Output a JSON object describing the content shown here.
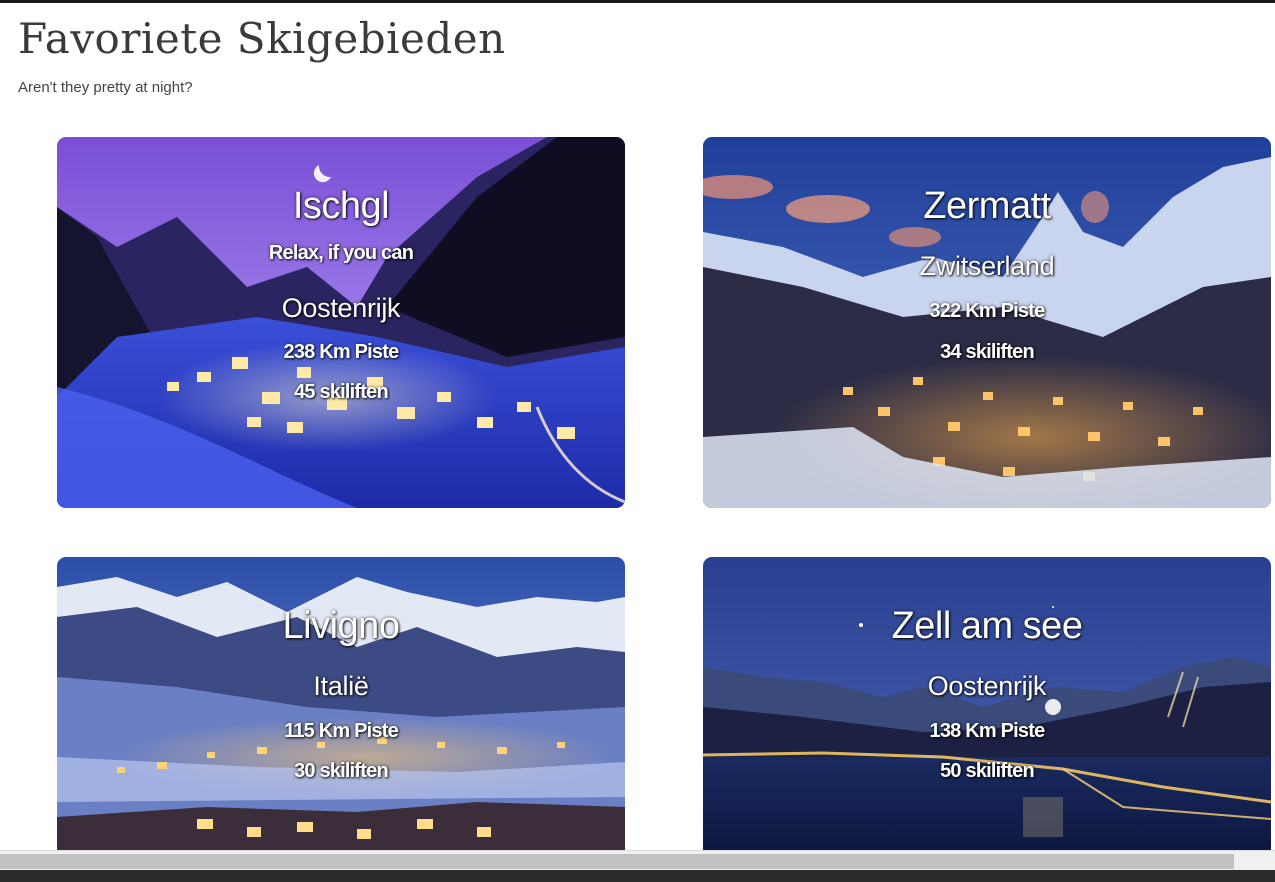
{
  "page": {
    "title": "Favoriete Skigebieden",
    "subtitle": "Aren't they pretty at night?"
  },
  "cards": [
    {
      "name": "Ischgl",
      "tagline": "Relax, if you can",
      "country": "Oostenrijk",
      "piste": "238 Km Piste",
      "lifts": "45 skiliften",
      "sky_color": "#8a5fd8"
    },
    {
      "name": "Zermatt",
      "country": "Zwitserland",
      "piste": "322 Km Piste",
      "lifts": "34 skiliften",
      "sky_color": "#2f4f9e"
    },
    {
      "name": "Livigno",
      "country": "Italië",
      "piste": "115 Km Piste",
      "lifts": "30 skiliften",
      "sky_color": "#3e64b8"
    },
    {
      "name": "Zell am see",
      "country": "Oostenrijk",
      "piste": "138 Km Piste",
      "lifts": "50 skiliften",
      "sky_color": "#2a3f8f"
    }
  ]
}
